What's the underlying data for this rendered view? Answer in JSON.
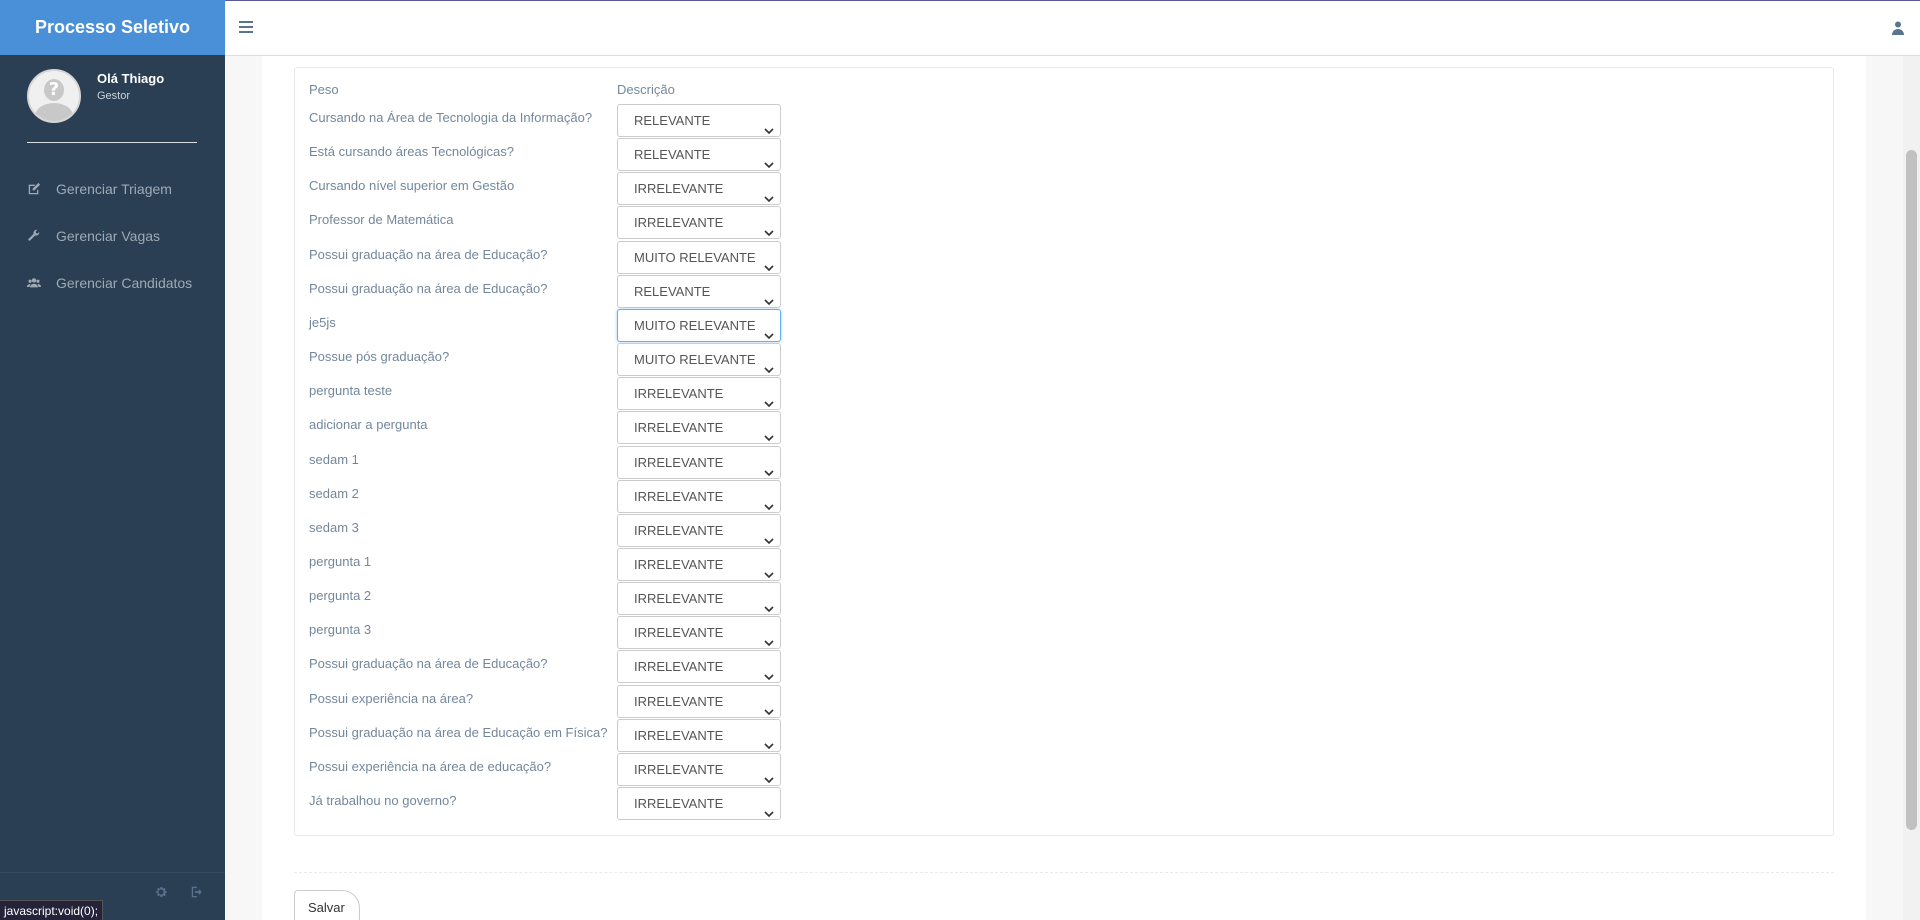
{
  "sidebar": {
    "brand": "Processo Seletivo",
    "user_name": "Olá Thiago",
    "user_role": "Gestor",
    "menu": [
      {
        "label": "Gerenciar Triagem",
        "icon": "edit-icon"
      },
      {
        "label": "Gerenciar Vagas",
        "icon": "wrench-icon"
      },
      {
        "label": "Gerenciar Candidatos",
        "icon": "users-icon"
      }
    ]
  },
  "form": {
    "col_peso": "Peso",
    "col_descricao": "Descrição",
    "rows": [
      {
        "label": "Cursando na Área de Tecnologia da Informação?",
        "value": "RELEVANTE"
      },
      {
        "label": "Está cursando áreas Tecnológicas?",
        "value": "RELEVANTE"
      },
      {
        "label": "Cursando nível superior em Gestão",
        "value": "IRRELEVANTE"
      },
      {
        "label": "Professor de Matemática",
        "value": "IRRELEVANTE"
      },
      {
        "label": "Possui graduação na área de Educação?",
        "value": "MUITO RELEVANTE"
      },
      {
        "label": "Possui graduação na área de Educação?",
        "value": "RELEVANTE"
      },
      {
        "label": "je5js",
        "value": "MUITO RELEVANTE",
        "focused": true
      },
      {
        "label": "Possue pós graduação?",
        "value": "MUITO RELEVANTE"
      },
      {
        "label": "pergunta teste",
        "value": "IRRELEVANTE"
      },
      {
        "label": "adicionar a pergunta",
        "value": "IRRELEVANTE"
      },
      {
        "label": "sedam 1",
        "value": "IRRELEVANTE"
      },
      {
        "label": "sedam 2",
        "value": "IRRELEVANTE"
      },
      {
        "label": "sedam 3",
        "value": "IRRELEVANTE"
      },
      {
        "label": "pergunta 1",
        "value": "IRRELEVANTE"
      },
      {
        "label": "pergunta 2",
        "value": "IRRELEVANTE"
      },
      {
        "label": "pergunta 3",
        "value": "IRRELEVANTE"
      },
      {
        "label": "Possui graduação na área de Educação?",
        "value": "IRRELEVANTE"
      },
      {
        "label": "Possui experiência na área?",
        "value": "IRRELEVANTE"
      },
      {
        "label": "Possui graduação na área de Educação em Física?",
        "value": "IRRELEVANTE"
      },
      {
        "label": "Possui experiência na área de educação?",
        "value": "IRRELEVANTE"
      },
      {
        "label": "Já trabalhou no governo?",
        "value": "IRRELEVANTE"
      }
    ],
    "save_label": "Salvar"
  },
  "status_bar": "javascript:void(0);",
  "colors": {
    "sidebar_bg": "#2a3f54",
    "brand_bg": "#4a90d9",
    "text": "#73879c"
  }
}
